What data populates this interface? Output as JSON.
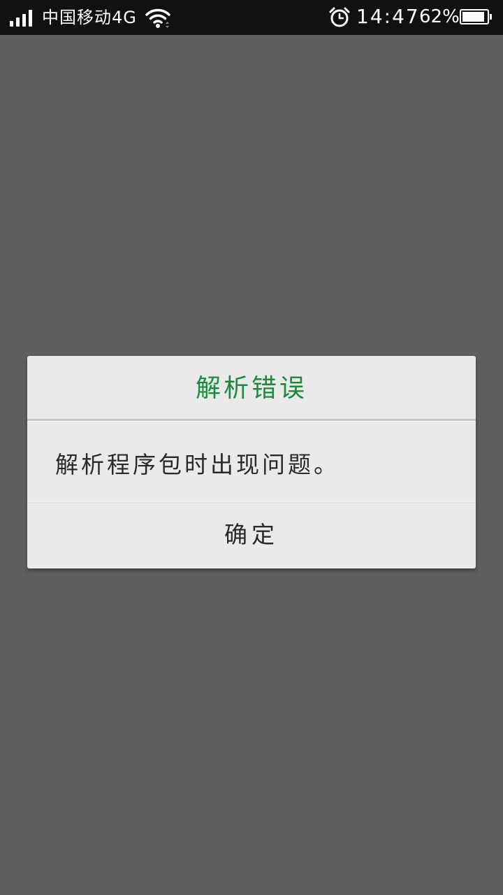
{
  "status_bar": {
    "carrier": "中国移动4G",
    "time": "14:47",
    "battery_percent": "62%",
    "battery_level": 0.9,
    "icons": [
      "signal-icon",
      "wifi-icon",
      "alarm-icon",
      "battery-icon"
    ]
  },
  "dialog": {
    "title": "解析错误",
    "message": "解析程序包时出现问题。",
    "ok_label": "确定",
    "title_color": "#1a8a3c"
  }
}
